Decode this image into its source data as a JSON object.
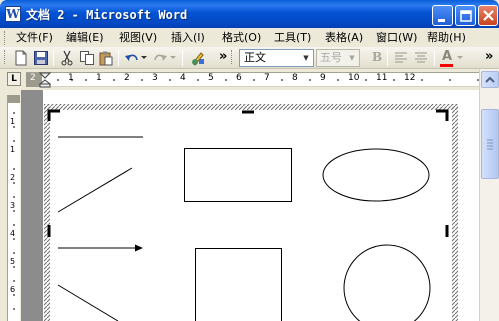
{
  "window": {
    "app_icon_letter": "W",
    "title": "文档 2 - Microsoft Word"
  },
  "menu": {
    "items": [
      {
        "label": "文件(F)"
      },
      {
        "label": "编辑(E)"
      },
      {
        "label": "视图(V)"
      },
      {
        "label": "插入(I)"
      },
      {
        "label": "格式(O)"
      },
      {
        "label": "工具(T)"
      },
      {
        "label": "表格(A)"
      },
      {
        "label": "窗口(W)"
      },
      {
        "label": "帮助(H)"
      }
    ]
  },
  "toolbar": {
    "style_value": "正文",
    "font_size_value": "五号",
    "bold_label": "B",
    "more_label": "»",
    "underline_color": "#ff0000",
    "font_color_letter": "A"
  },
  "ruler": {
    "tab_selector": "L",
    "h_numbers": [
      "2",
      "1",
      "1",
      "2",
      "3",
      "4",
      "5",
      "6",
      "7",
      "8",
      "9",
      "10",
      "11",
      "12"
    ],
    "v_numbers": [
      "1",
      "1",
      "2",
      "3",
      "4",
      "5",
      "6"
    ]
  },
  "colors": {
    "titlebar": "#0a5ed7",
    "workspace": "#8c8c8c",
    "chrome": "#ece9d8"
  },
  "icons": [
    "new-document-icon",
    "save-icon",
    "cut-icon",
    "copy-icon",
    "paste-icon",
    "undo-icon",
    "redo-icon",
    "drawing-icon",
    "align-left-icon",
    "align-center-icon",
    "font-color-icon"
  ]
}
